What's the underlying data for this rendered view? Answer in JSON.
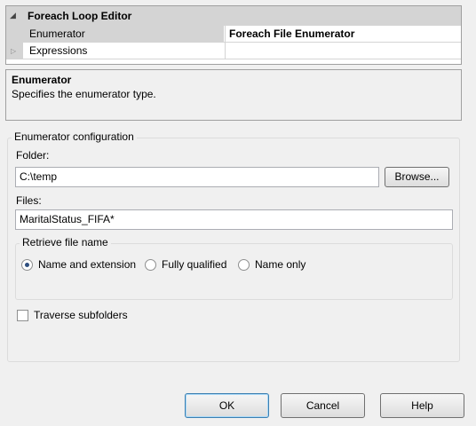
{
  "property_grid": {
    "category": "Foreach Loop Editor",
    "rows": [
      {
        "name": "Enumerator",
        "value": "Foreach File Enumerator"
      },
      {
        "name": "Expressions",
        "value": ""
      }
    ]
  },
  "description": {
    "title": "Enumerator",
    "text": "Specifies the enumerator type."
  },
  "config": {
    "legend": "Enumerator configuration",
    "folder_label": "Folder:",
    "folder_value": "C:\\temp",
    "browse_label": "Browse...",
    "files_label": "Files:",
    "files_value": "MaritalStatus_FIFA*",
    "retrieve": {
      "legend": "Retrieve file name",
      "options": [
        "Name and extension",
        "Fully qualified",
        "Name only"
      ],
      "selected": "Name and extension"
    },
    "traverse_label": "Traverse subfolders",
    "traverse_checked": false
  },
  "buttons": {
    "ok": "OK",
    "cancel": "Cancel",
    "help": "Help"
  }
}
